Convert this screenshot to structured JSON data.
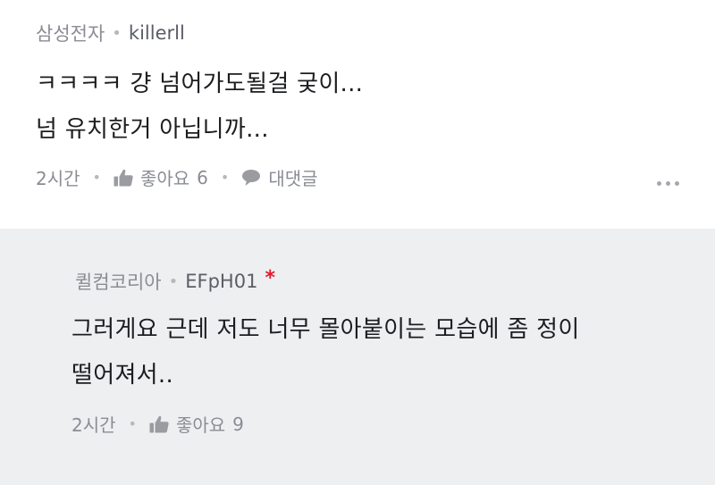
{
  "comments": [
    {
      "nickname": "삼성전자",
      "user_id": "killerll",
      "text_lines": [
        "ㅋㅋㅋㅋ  걍 넘어가도될걸 궂이...",
        "넘 유치한거 아닙니까..."
      ],
      "time": "2시간",
      "like_label": "좋아요",
      "like_count": "6",
      "reply_label": "대댓글"
    },
    {
      "nickname": "퀼컴코리아",
      "user_id": "EFpH01",
      "author_mark": "*",
      "text_lines": [
        "그러게요 근데 저도 너무 몰아붙이는 모습에 좀 정이",
        "떨어져서.."
      ],
      "time": "2시간",
      "like_label": "좋아요",
      "like_count": "9"
    }
  ],
  "separator_glyph": "•",
  "icons": {
    "like": "thumbs-up-icon",
    "reply": "speech-bubble-icon",
    "more": "more-dots-icon"
  },
  "colors": {
    "reply_background": "#eeeff1",
    "author_mark": "#e8192c"
  }
}
